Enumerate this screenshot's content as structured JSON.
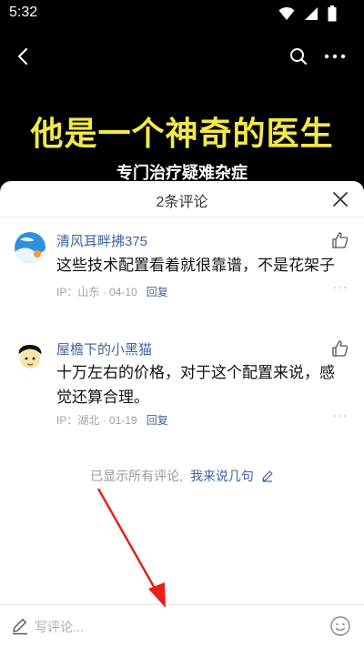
{
  "status_bar": {
    "time": "5:32"
  },
  "video": {
    "title": "他是一个神奇的医生",
    "subtitle": "专门治疗疑难杂症"
  },
  "comments_panel": {
    "title": "2条评论",
    "comments": [
      {
        "name": "清风耳畔拂375",
        "text": "这些技术配置看着就很靠谱，不是花架子",
        "ip_label": "IP：",
        "location": "山东",
        "date": "04-10",
        "reply": "回复",
        "more": "···"
      },
      {
        "name": "屋檐下的小黑猫",
        "text": "十万左右的价格，对于这个配置来说，感觉还算合理。",
        "ip_label": "IP：",
        "location": "湖北",
        "date": "01-19",
        "reply": "回复",
        "more": "···"
      }
    ],
    "end_note": "已显示所有评论,",
    "end_cta": "我来说几句"
  },
  "input_bar": {
    "placeholder": "写评论..."
  },
  "colors": {
    "link": "#41639c",
    "title_yellow": "#f2e84a",
    "arrow": "#e8201a"
  }
}
